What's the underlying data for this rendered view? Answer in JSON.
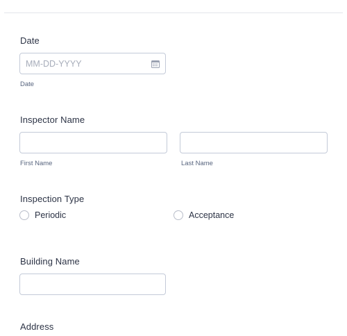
{
  "form": {
    "date": {
      "label": "Date",
      "placeholder": "MM-DD-YYYY",
      "value": "",
      "sublabel": "Date",
      "icon": "calendar-icon"
    },
    "inspector_name": {
      "label": "Inspector Name",
      "first_name_sublabel": "First Name",
      "last_name_sublabel": "Last Name",
      "first_name_value": "",
      "last_name_value": ""
    },
    "inspection_type": {
      "label": "Inspection Type",
      "options": [
        "Periodic",
        "Acceptance"
      ],
      "selected": null
    },
    "building_name": {
      "label": "Building Name",
      "value": ""
    },
    "address": {
      "label": "Address"
    }
  },
  "colors": {
    "text": "#2c3345",
    "sublabel": "#57647e",
    "border": "#c3cad8",
    "placeholder": "#a7adba",
    "divider": "#e3e5ea"
  }
}
